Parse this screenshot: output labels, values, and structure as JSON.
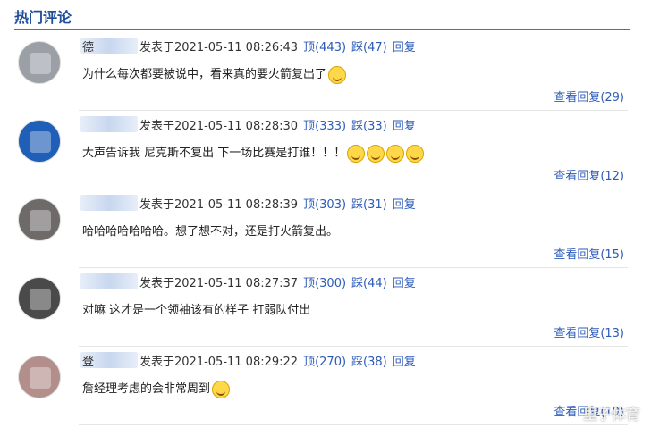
{
  "header": {
    "title": "热门评论"
  },
  "comments": [
    {
      "name_hint": "德",
      "posted": "发表于2021-05-11 08:26:43",
      "up": "顶(443)",
      "down": "踩(47)",
      "reply": "回复",
      "text": "为什么每次都要被说中，看来真的要火箭复出了",
      "emojis": 1,
      "view_replies": "查看回复(29)",
      "avatar_color": "#9aa0a6"
    },
    {
      "name_hint": "",
      "posted": "发表于2021-05-11 08:28:30",
      "up": "顶(333)",
      "down": "踩(33)",
      "reply": "回复",
      "text": "大声告诉我 尼克斯不复出 下一场比赛是打谁！！！",
      "emojis": 4,
      "view_replies": "查看回复(12)",
      "avatar_color": "#1f5fb7"
    },
    {
      "name_hint": "",
      "posted": "发表于2021-05-11 08:28:39",
      "up": "顶(303)",
      "down": "踩(31)",
      "reply": "回复",
      "text": "哈哈哈哈哈哈哈。想了想不对，还是打火箭复出。",
      "emojis": 0,
      "view_replies": "查看回复(15)",
      "avatar_color": "#6e6a6a"
    },
    {
      "name_hint": "",
      "posted": "发表于2021-05-11 08:27:37",
      "up": "顶(300)",
      "down": "踩(44)",
      "reply": "回复",
      "text": "对嘛 这才是一个领袖该有的样子 打弱队付出",
      "emojis": 0,
      "view_replies": "查看回复(13)",
      "avatar_color": "#4a4a4a"
    },
    {
      "name_hint": "登",
      "posted": "发表于2021-05-11 08:29:22",
      "up": "顶(270)",
      "down": "踩(38)",
      "reply": "回复",
      "text": "詹经理考虑的会非常周到",
      "emojis": 1,
      "view_replies": "查看回复(10)",
      "avatar_color": "#b28f8a"
    }
  ],
  "watermark": "里子体育"
}
